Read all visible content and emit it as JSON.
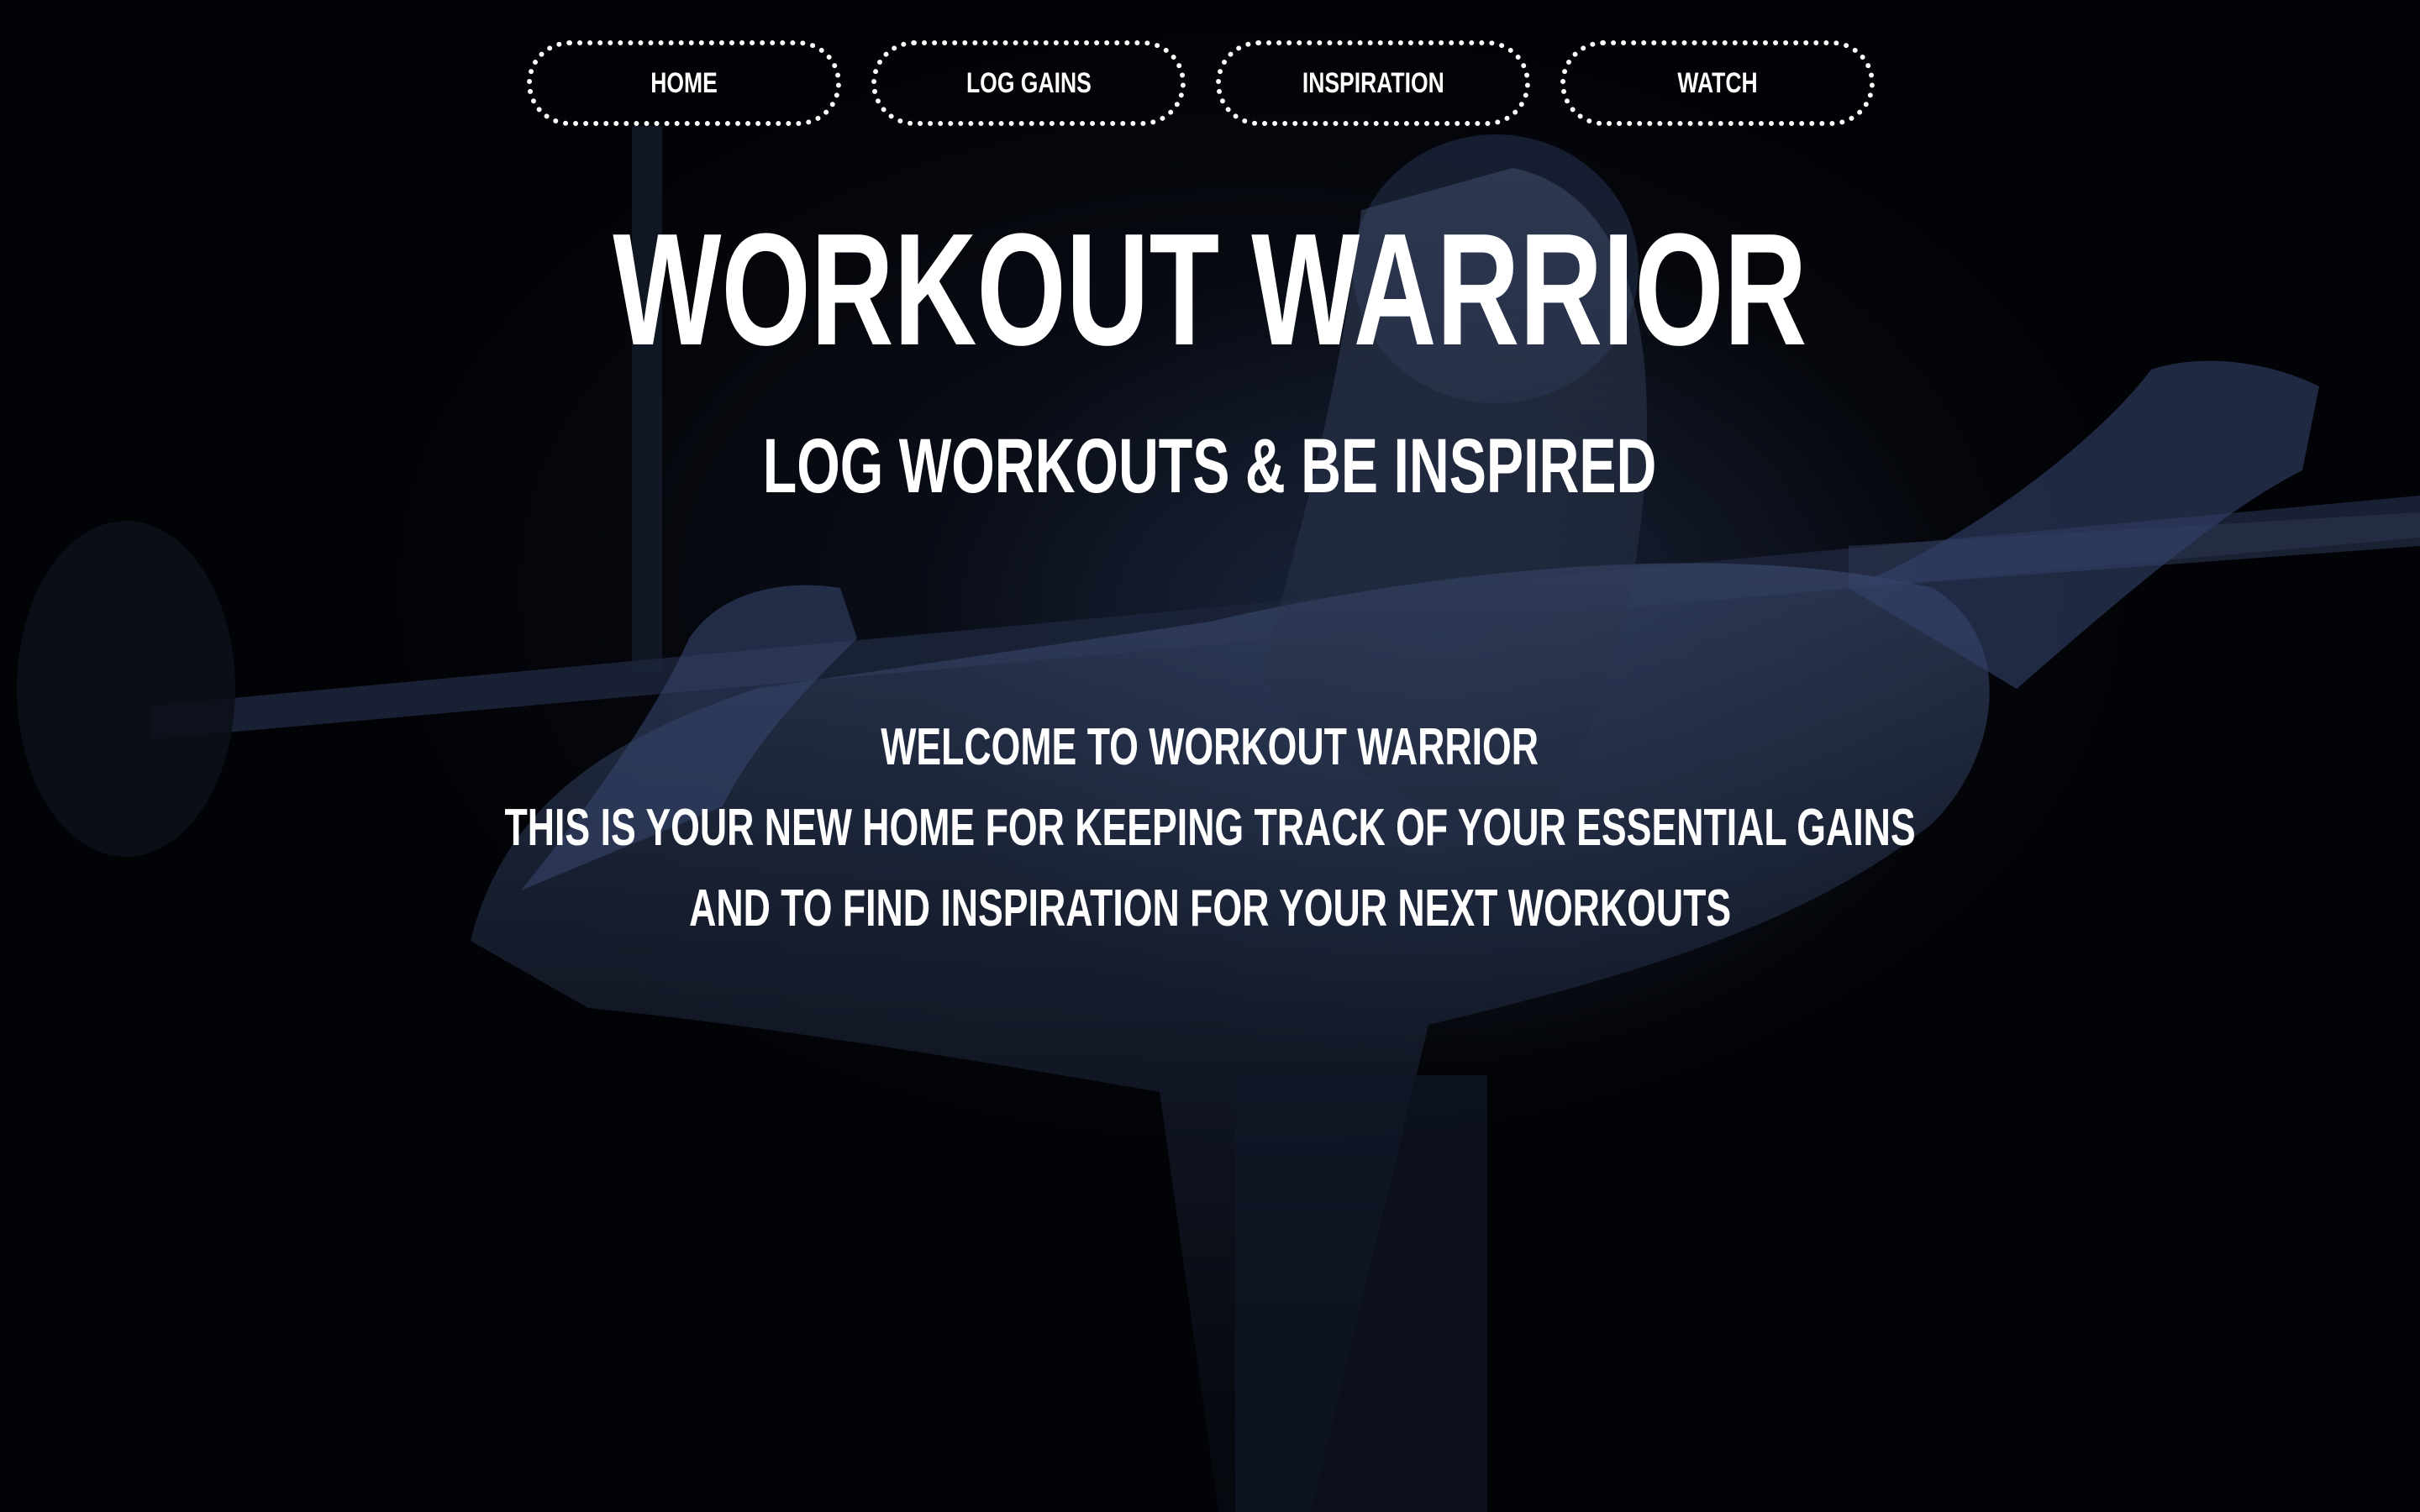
{
  "nav": {
    "items": [
      {
        "label": "HOME"
      },
      {
        "label": "LOG GAINS"
      },
      {
        "label": "INSPIRATION"
      },
      {
        "label": "WATCH"
      }
    ]
  },
  "hero": {
    "title": "WORKOUT WARRIOR",
    "subtitle": "LOG WORKOUTS & BE INSPIRED",
    "intro_lines": [
      "WELCOME TO WORKOUT WARRIOR",
      "THIS IS YOUR NEW HOME FOR KEEPING TRACK OF YOUR ESSENTIAL GAINS",
      "AND TO FIND INSPIRATION FOR YOUR NEXT WORKOUTS"
    ]
  },
  "colors": {
    "background": "#020306",
    "overlay_tint": "#283755",
    "text": "#ffffff"
  }
}
